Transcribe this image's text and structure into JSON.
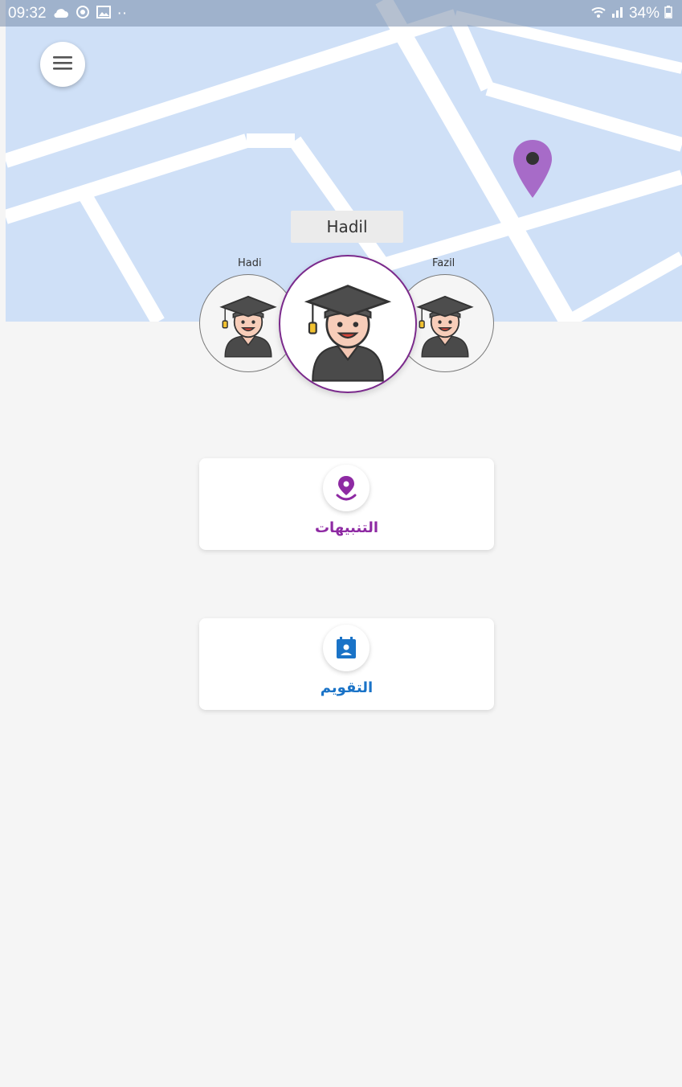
{
  "status_bar": {
    "time": "09:32",
    "dots": "··",
    "battery": "34%"
  },
  "map": {
    "background_color": "#cfe0f7",
    "road_color": "#ffffff",
    "pin_color": "#a76bc8"
  },
  "selected_child": {
    "name": "Hadil"
  },
  "children": [
    {
      "name": "Hadi"
    },
    {
      "name": "Hadil"
    },
    {
      "name": "Fazil"
    }
  ],
  "cards": [
    {
      "label": "التنبيهات",
      "icon": "location-alert-icon",
      "color": "#8e2aa3"
    },
    {
      "label": "التقويم",
      "icon": "calendar-person-icon",
      "color": "#1a73c7"
    }
  ],
  "colors": {
    "accent_purple": "#7b2a8c",
    "accent_blue": "#1a73c7",
    "background": "#f5f5f5"
  }
}
